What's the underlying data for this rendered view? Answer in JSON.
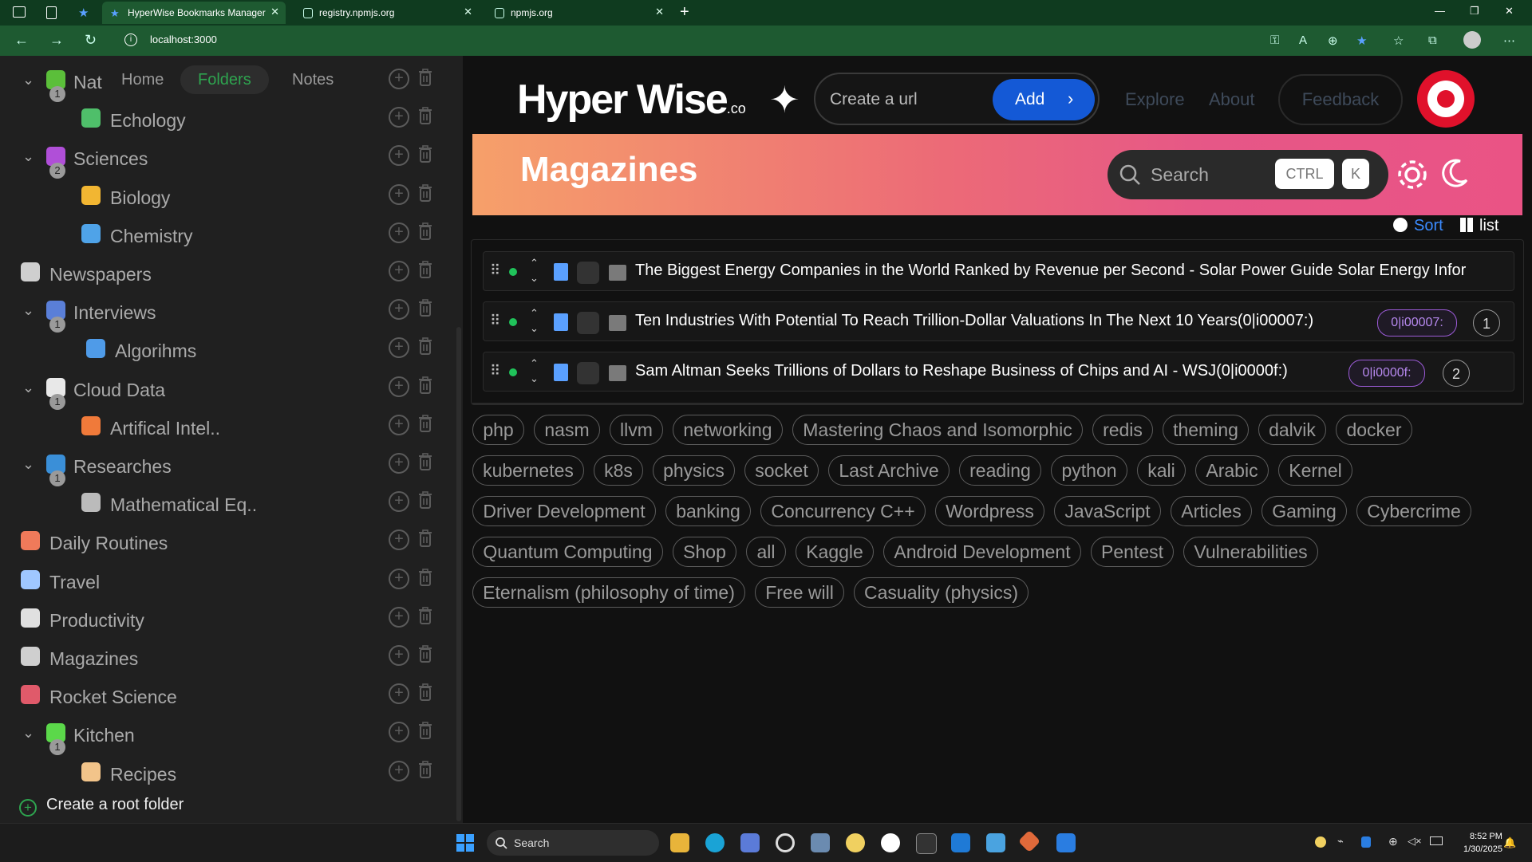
{
  "browser": {
    "tabs": [
      {
        "title": "HyperWise Bookmarks Manager",
        "active": true
      },
      {
        "title": "registry.npmjs.org",
        "active": false
      },
      {
        "title": "npmjs.org",
        "active": false
      }
    ],
    "address": "localhost:3000"
  },
  "sidebar": {
    "tabs": [
      "Home",
      "Folders",
      "Notes"
    ],
    "active_tab": "Folders",
    "items": [
      {
        "label": "Nat",
        "expanded": true,
        "badge": "1",
        "icon": "plant-icon",
        "level": 0
      },
      {
        "label": "Echology",
        "icon": "leaf-icon",
        "level": 1
      },
      {
        "label": "Sciences",
        "expanded": true,
        "badge": "2",
        "icon": "folder-icon",
        "level": 0
      },
      {
        "label": "Biology",
        "icon": "sun-face-icon",
        "level": 1
      },
      {
        "label": "Chemistry",
        "icon": "robot-icon",
        "level": 1
      },
      {
        "label": "Newspapers",
        "icon": "newspaper-icon",
        "level": 0
      },
      {
        "label": "Interviews",
        "expanded": true,
        "badge": "1",
        "icon": "ship-icon",
        "level": 0
      },
      {
        "label": "Algorihms",
        "icon": "folder-icon",
        "level": 2
      },
      {
        "label": "Cloud Data",
        "expanded": true,
        "badge": "1",
        "icon": "cloud-icon",
        "level": 0
      },
      {
        "label": "Artifical Intel..",
        "icon": "rainbow-icon",
        "level": 1
      },
      {
        "label": "Researches",
        "expanded": true,
        "badge": "1",
        "icon": "globe-icon",
        "level": 0
      },
      {
        "label": "Mathematical Eq..",
        "icon": "ruler-icon",
        "level": 1
      },
      {
        "label": "Daily Routines",
        "icon": "sunrise-icon",
        "level": 0
      },
      {
        "label": "Travel",
        "icon": "train-icon",
        "level": 0
      },
      {
        "label": "Productivity",
        "icon": "clock-icon",
        "level": 0
      },
      {
        "label": "Magazines",
        "icon": "newspaper-icon",
        "level": 0
      },
      {
        "label": "Rocket Science",
        "icon": "rocket-icon",
        "level": 0
      },
      {
        "label": "Kitchen",
        "expanded": true,
        "badge": "1",
        "icon": "cog-icon",
        "level": 0
      },
      {
        "label": "Recipes",
        "icon": "chef-icon",
        "level": 1
      }
    ],
    "create_root": "Create a root folder"
  },
  "header": {
    "logo": "Hyper Wise",
    "logo_suffix": ".co",
    "url_placeholder": "Create a url",
    "add_label": "Add",
    "nav": [
      "Explore",
      "About"
    ],
    "feedback": "Feedback"
  },
  "banner": {
    "title": "Magazines",
    "search_placeholder": "Search",
    "kbd1": "CTRL",
    "kbd2": "K"
  },
  "controls": {
    "sort": "Sort",
    "view": "list"
  },
  "bookmarks": [
    {
      "title": "The Biggest Energy Companies in the World Ranked by Revenue per Second - Solar Power Guide Solar Energy Infor",
      "code": "",
      "count": ""
    },
    {
      "title": "Ten Industries With Potential To Reach Trillion-Dollar Valuations In The Next 10 Years(0|i00007:)",
      "code": "0|i00007:",
      "count": "1"
    },
    {
      "title": "Sam Altman Seeks Trillions of Dollars to Reshape Business of Chips and AI - WSJ(0|i0000f:)",
      "code": "0|i0000f:",
      "count": "2"
    }
  ],
  "tags": [
    "php",
    "nasm",
    "llvm",
    "networking",
    "Mastering Chaos and Isomorphic",
    "redis",
    "theming",
    "dalvik",
    "docker",
    "kubernetes",
    "k8s",
    "physics",
    "socket",
    "Last Archive",
    "reading",
    "python",
    "kali",
    "Arabic",
    "Kernel",
    "Driver Development",
    "banking",
    "Concurrency C++",
    "Wordpress",
    "JavaScript",
    "Articles",
    "Gaming",
    "Cybercrime",
    "Quantum Computing",
    "Shop",
    "all",
    "Kaggle",
    "Android Development",
    "Pentest",
    "Vulnerabilities",
    "Eternalism (philosophy of time)",
    "Free will",
    "Casuality (physics)"
  ],
  "taskbar": {
    "search": "Search",
    "time": "8:52 PM",
    "date": "1/30/2025"
  },
  "colors": {
    "accent_green": "#2ea44f",
    "add_blue": "#1459d6",
    "code_purple": "#9c5bd8",
    "target_red": "#e0112b"
  }
}
